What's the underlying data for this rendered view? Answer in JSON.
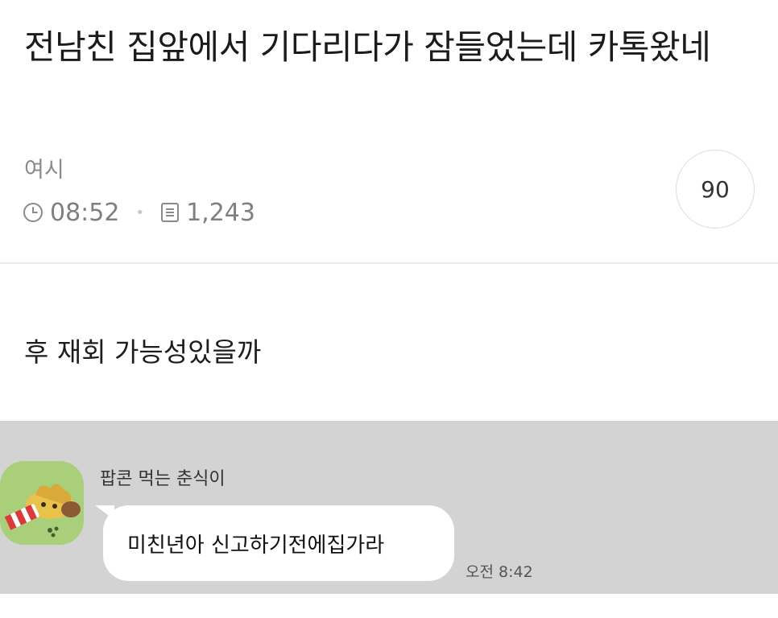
{
  "post": {
    "title": "전남친 집앞에서 기다리다가 잠들었는데 카톡왔네",
    "author": "여시",
    "time": "08:52",
    "views": "1,243",
    "comment_count": "90",
    "body": "후 재회 가능성있을까"
  },
  "chat": {
    "sender_name": "팝콘 먹는 춘식이",
    "message": "미친년아 신고하기전에집가라",
    "time": "오전 8:42"
  },
  "icons": {
    "time": "clock-icon",
    "views": "document-icon"
  },
  "colors": {
    "chat_background": "#d3d3d3",
    "bubble": "#ffffff",
    "avatar_background": "#a9cf7a",
    "meta_text": "#7f7f7f"
  }
}
